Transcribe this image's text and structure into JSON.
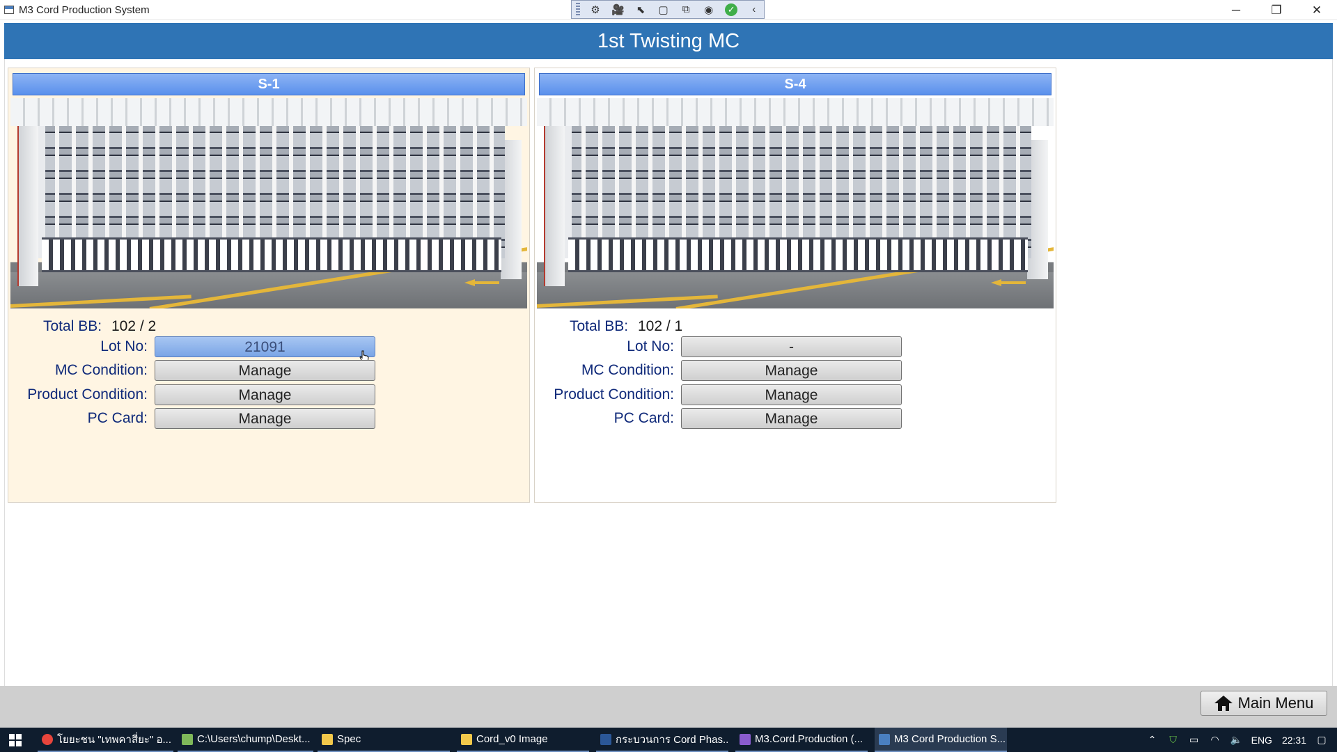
{
  "window": {
    "title": "M3 Cord Production System",
    "controls": {
      "minimize": "─",
      "restore": "❐",
      "close": "✕"
    }
  },
  "recorder_toolbar": {
    "buttons": [
      "record-settings-icon",
      "video-icon",
      "select-pointer-icon",
      "region-icon",
      "capture-icon",
      "audio-icon",
      "confirm-icon",
      "collapse-icon"
    ],
    "glyphs": [
      "⚙",
      "🎥",
      "⬉",
      "▢",
      "⧉",
      "◉",
      "✓",
      "‹"
    ]
  },
  "header": {
    "title": "1st Twisting MC"
  },
  "machines": [
    {
      "name": "S-1",
      "highlighted": true,
      "total_bb_label": "Total BB:",
      "total_bb_value": "102 / 2",
      "lot_label": "Lot No:",
      "lot_value": "21091",
      "mc_condition_label": "MC Condition:",
      "mc_condition_button": "Manage",
      "product_condition_label": "Product Condition:",
      "product_condition_button": "Manage",
      "pc_card_label": "PC Card:",
      "pc_card_button": "Manage"
    },
    {
      "name": "S-4",
      "highlighted": false,
      "total_bb_label": "Total BB:",
      "total_bb_value": "102 / 1",
      "lot_label": "Lot No:",
      "lot_value": "-",
      "mc_condition_label": "MC Condition:",
      "mc_condition_button": "Manage",
      "product_condition_label": "Product Condition:",
      "product_condition_button": "Manage",
      "pc_card_label": "PC Card:",
      "pc_card_button": "Manage"
    }
  ],
  "footer": {
    "main_menu_label": "Main Menu"
  },
  "taskbar": {
    "items": [
      {
        "label": "โยยะชน \"เทพคาสี่ยะ\" อ...",
        "icon": "chrome-icon",
        "color": "#e8453c"
      },
      {
        "label": "C:\\Users\\chump\\Deskt...",
        "icon": "notepad-icon",
        "color": "#7fb85a"
      },
      {
        "label": "Spec",
        "icon": "folder-icon",
        "color": "#f2c84b"
      },
      {
        "label": "Cord_v0 Image",
        "icon": "folder-icon",
        "color": "#f2c84b"
      },
      {
        "label": "กระบวนการ Cord Phas...",
        "icon": "word-icon",
        "color": "#2b5797"
      },
      {
        "label": "M3.Cord.Production (...",
        "icon": "visual-studio-icon",
        "color": "#8a5ccf"
      },
      {
        "label": "M3 Cord Production S...",
        "icon": "app-window-icon",
        "color": "#4a7fc0"
      }
    ],
    "tray": {
      "language": "ENG",
      "time": "22:31"
    }
  },
  "colors": {
    "header_bg": "#2f74b5",
    "active_card_bg": "#fff5e3",
    "card_title_bg": "#5a90ec",
    "label_text": "#102a7a",
    "taskbar_bg": "#0f1d2e"
  }
}
